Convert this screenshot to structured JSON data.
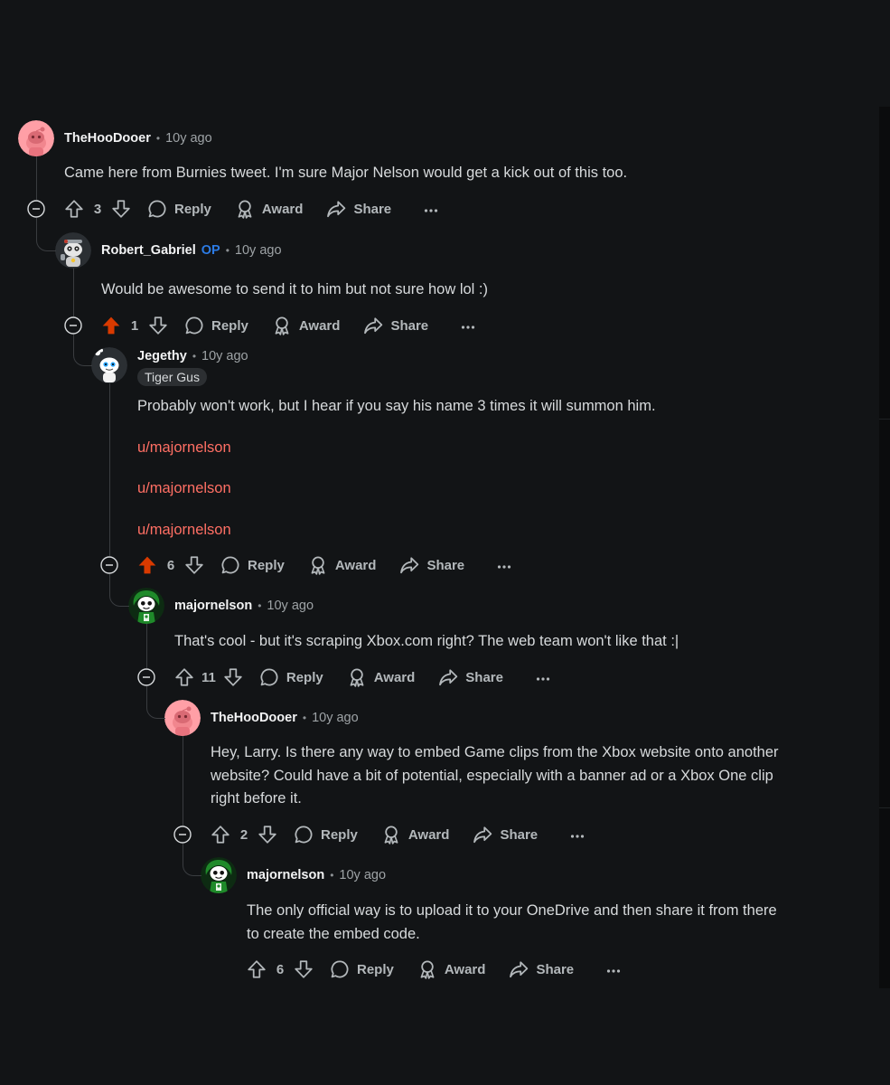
{
  "op_label": "OP",
  "actions": {
    "reply": "Reply",
    "award": "Award",
    "share": "Share"
  },
  "icons": {
    "collapse": "minus-circle-icon",
    "upvote": "arrow-up-icon",
    "downvote": "arrow-down-icon",
    "reply": "chat-bubble-icon",
    "award": "award-ribbon-icon",
    "share": "share-arrow-icon",
    "more": "more-horizontal-icon"
  },
  "colors": {
    "background": "#121416",
    "upvoted": "#d93a00",
    "user_link": "#ff6f64",
    "op_badge": "#2c7be5"
  },
  "comments": [
    {
      "username": "TheHooDooer",
      "time": "10y ago",
      "body": [
        "Came here from Burnies tweet. I'm sure Major Nelson would get a kick out of this too."
      ],
      "score": "3",
      "upvoted": false
    },
    {
      "username": "Robert_Gabriel",
      "is_op": true,
      "time": "10y ago",
      "body": [
        "Would be awesome to send it to him but not sure how lol :)"
      ],
      "score": "1",
      "upvoted": true
    },
    {
      "username": "Jegethy",
      "flair": "Tiger Gus",
      "time": "10y ago",
      "body": [
        "Probably won't work, but I hear if you say his name 3 times it will summon him."
      ],
      "links": [
        "u/majornelson",
        "u/majornelson",
        "u/majornelson"
      ],
      "score": "6",
      "upvoted": true
    },
    {
      "username": "majornelson",
      "time": "10y ago",
      "body": [
        "That's cool - but it's scraping Xbox.com right? The web team won't like that :|"
      ],
      "score": "11",
      "upvoted": false
    },
    {
      "username": "TheHooDooer",
      "time": "10y ago",
      "body": [
        "Hey, Larry. Is there any way to embed Game clips from the Xbox website onto another",
        "website? Could have a bit of potential, especially with a banner ad or a Xbox One clip",
        "right before it."
      ],
      "score": "2",
      "upvoted": false
    },
    {
      "username": "majornelson",
      "time": "10y ago",
      "body": [
        "The only official way is to upload it to your OneDrive and then share it from there",
        "to create the embed code."
      ],
      "score": "6",
      "upvoted": false
    }
  ]
}
